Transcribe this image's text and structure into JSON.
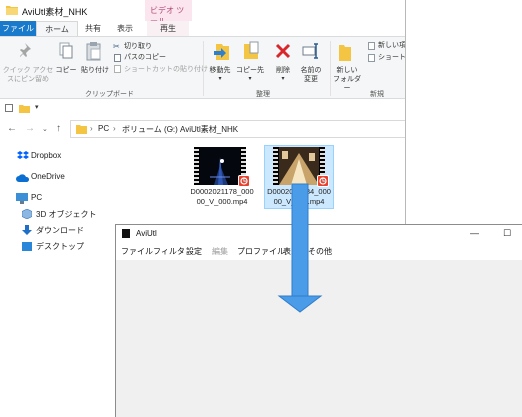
{
  "explorer": {
    "title": "AviUtl素材_NHK",
    "context_tab": "ビデオ ツール",
    "tabs": [
      "ファイル",
      "ホーム",
      "共有",
      "表示",
      "再生"
    ],
    "ribbon": {
      "pin_line1": "クイック アクセ",
      "pin_line2": "スにピン留め",
      "copy": "コピー",
      "paste": "貼り付け",
      "cut": "切り取り",
      "copy_path": "パスのコピー",
      "paste_shortcut": "ショートカットの貼り付け",
      "clipboard_group": "クリップボード",
      "move_to": "移動先",
      "copy_to": "コピー先",
      "delete": "削除",
      "rename_line1": "名前の",
      "rename_line2": "変更",
      "organize_group": "整理",
      "new_folder_line1": "新しい",
      "new_folder_line2": "フォルダー",
      "new_item": "新しい項",
      "shortcut": "ショートカ",
      "new_group": "新規"
    },
    "breadcrumb": [
      "PC",
      "ボリューム (G:)",
      "AviUtl素材_NHK"
    ],
    "sidebar": [
      "Dropbox",
      "OneDrive",
      "PC",
      "3D オブジェクト",
      "ダウンロード",
      "デスクトップ"
    ],
    "files": [
      {
        "name_line1": "D0002021178_000",
        "name_line2": "00_V_000.mp4"
      },
      {
        "name_line1": "D0002050384_000",
        "name_line2": "00_V_000.mp4"
      }
    ]
  },
  "aviutl": {
    "title": "AviUtl",
    "menu": [
      "ファイル",
      "フィルタ",
      "設定",
      "編集",
      "プロファイル",
      "表示",
      "その他"
    ],
    "minimize": "—",
    "maximize": "☐"
  },
  "colors": {
    "accent": "#1979ca",
    "selection": "#cce8ff",
    "arrow": "#4a9be8",
    "context_tab": "#fbe5ee"
  }
}
